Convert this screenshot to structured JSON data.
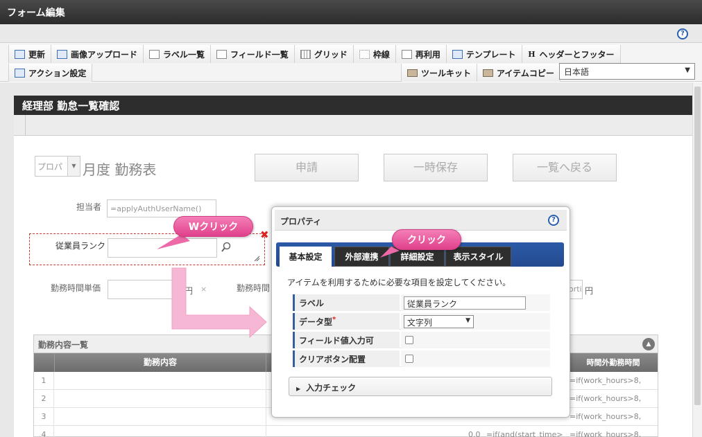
{
  "window": {
    "title": "フォーム編集"
  },
  "toolbar": {
    "row1": [
      {
        "label": "更新",
        "icon": "refresh-icon"
      },
      {
        "label": "画像アップロード",
        "icon": "image-upload-icon"
      },
      {
        "label": "ラベル一覧",
        "icon": "label-list-icon"
      },
      {
        "label": "フィールド一覧",
        "icon": "field-list-icon"
      },
      {
        "label": "グリッド",
        "icon": "grid-icon"
      },
      {
        "label": "枠線",
        "icon": "border-icon"
      },
      {
        "label": "再利用",
        "icon": "reuse-icon"
      },
      {
        "label": "テンプレート",
        "icon": "template-icon"
      },
      {
        "label": "ヘッダーとフッター",
        "icon": "header-footer-icon"
      }
    ],
    "action_settings": "アクション設定",
    "toolkit": "ツールキット",
    "item_copy": "アイテムコピー",
    "language": "日本語"
  },
  "form": {
    "title": "経理部 勤怠一覧確認",
    "month_select": "プロパ",
    "heading": "月度 勤務表",
    "buttons": {
      "apply": "申請",
      "temp_save": "一時保存",
      "back_to_list": "一覧へ戻る"
    },
    "assignee_label": "担当者",
    "assignee_value": "=applyAuthUserName()",
    "rank_label": "従業員ランク",
    "unit_price_label": "勤務時間単価",
    "unit_yen": "円",
    "times": "×",
    "work_time_label": "勤務時間",
    "right_field_value": "orti",
    "right_unit": "円"
  },
  "table": {
    "title": "勤務内容一覧",
    "col_content": "勤務内容",
    "col_overtime": "時間外勤務時間",
    "rows": [
      {
        "num": "1",
        "formula": "=if(work_hours>8,"
      },
      {
        "num": "2",
        "formula": "=if(work_hours>8,"
      },
      {
        "num": "3",
        "formula": "=if(work_hours>8,"
      },
      {
        "num": "4",
        "hours": "0.0",
        "mid_formula": "=if(and(start_time>",
        "formula": "=if(work_hours>8,"
      }
    ]
  },
  "properties": {
    "title": "プロパティ",
    "tabs": [
      "基本設定",
      "外部連携",
      "詳細設定",
      "表示スタイル"
    ],
    "description": "アイテムを利用するために必要な項目を設定してください。",
    "fields": {
      "label": {
        "name": "ラベル",
        "value": "従業員ランク"
      },
      "data_type": {
        "name": "データ型",
        "required": "*",
        "value": "文字列"
      },
      "field_input": {
        "name": "フィールド値入力可"
      },
      "clear_button": {
        "name": "クリアボタン配置"
      }
    },
    "input_check": "入力チェック"
  },
  "annotations": {
    "double_click": "Wクリック",
    "click": "クリック"
  }
}
